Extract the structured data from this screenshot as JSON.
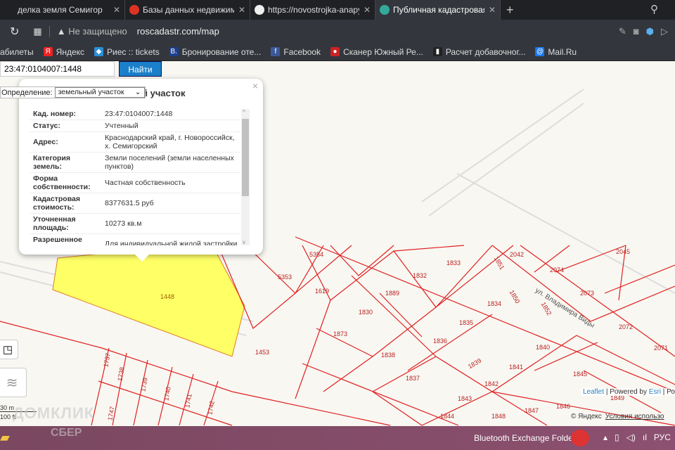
{
  "browser": {
    "tabs": [
      {
        "label": "делка земля Семигор",
        "active": false,
        "icon_color": "#1f2125"
      },
      {
        "label": "Базы данных недвижимос",
        "active": false,
        "icon_color": "#d32"
      },
      {
        "label": "https://novostrojka-anapy.r",
        "active": false,
        "icon_color": "#eee"
      },
      {
        "label": "Публичная кадастровая к",
        "active": true,
        "icon_color": "#3a9"
      }
    ],
    "new_tab": "+",
    "security": "Не защищено",
    "url": "roscadastr.com/map",
    "bookmarks": [
      {
        "label": "абилеты",
        "icon": "",
        "color": ""
      },
      {
        "label": "Яндекс",
        "icon": "Я",
        "color": "#e22"
      },
      {
        "label": "Риес :: tickets",
        "icon": "◆",
        "color": "#2a8fd8"
      },
      {
        "label": "Бронирование оте...",
        "icon": "B.",
        "color": "#1c3f8f"
      },
      {
        "label": "Facebook",
        "icon": "f",
        "color": "#3b5998"
      },
      {
        "label": "Сканер Южный Ре...",
        "icon": "●",
        "color": "#c22"
      },
      {
        "label": "Расчет добавочног...",
        "icon": "▮",
        "color": "#222"
      },
      {
        "label": "Mail.Ru",
        "icon": "@",
        "color": "#1877f2"
      }
    ]
  },
  "search": {
    "value": "23:47:0104007:1448",
    "button": "Найти"
  },
  "definition": {
    "label": "Определение:",
    "selected": "земельный участок"
  },
  "popup": {
    "title": "й участок",
    "close": "×",
    "rows": [
      {
        "key": "Кад. номер:",
        "value": "23:47:0104007:1448"
      },
      {
        "key": "Статус:",
        "value": "Учтенный"
      },
      {
        "key": "Адрес:",
        "value": "Краснодарский край, г. Новороссийск, х. Семигорский"
      },
      {
        "key": "Категория земель:",
        "value": "Земли поселений (земли населенных пунктов)"
      },
      {
        "key": "Форма собственности:",
        "value": "Частная собственность"
      },
      {
        "key": "Кадастровая стоимость:",
        "value": "8377631.5 руб"
      },
      {
        "key": "Уточненная площадь:",
        "value": "10273 кв.м"
      },
      {
        "key": "Разрешенное использование:",
        "value": "Для индивидуальной жилой застройки"
      }
    ]
  },
  "map": {
    "selected_parcel": "1448",
    "selected_color": "#ffff66",
    "parcel_color": "#e02020",
    "street": "ул. Владимира Виды",
    "parcels": [
      "5354",
      "5353",
      "1619",
      "1832",
      "1833",
      "1851",
      "2042",
      "2074",
      "2045",
      "1889",
      "1830",
      "1834",
      "1850",
      "1852",
      "2073",
      "1835",
      "2072",
      "1873",
      "1836",
      "1840",
      "2071",
      "1453",
      "1838",
      "1839",
      "1841",
      "1845",
      "1837",
      "1842",
      "1843",
      "1846",
      "1849",
      "1847",
      "1844",
      "1848",
      "1737",
      "1738",
      "1739",
      "1740",
      "1741",
      "1742",
      "1747"
    ],
    "scale": {
      "metric": "30 m",
      "imperial": "100 ft"
    },
    "attribution": {
      "leaflet": "Leaflet",
      "powered": "| Powered by",
      "esri": "Esri",
      "rest": "| Рос"
    },
    "yandex": {
      "copy": "© Яндекс",
      "terms": "Условия использо"
    }
  },
  "watermarks": {
    "top": "ДОМКЛИК",
    "bottom": "СБЕР"
  },
  "taskbar": {
    "bluetooth": "Bluetooth Exchange Folder",
    "lang": "РУС"
  }
}
